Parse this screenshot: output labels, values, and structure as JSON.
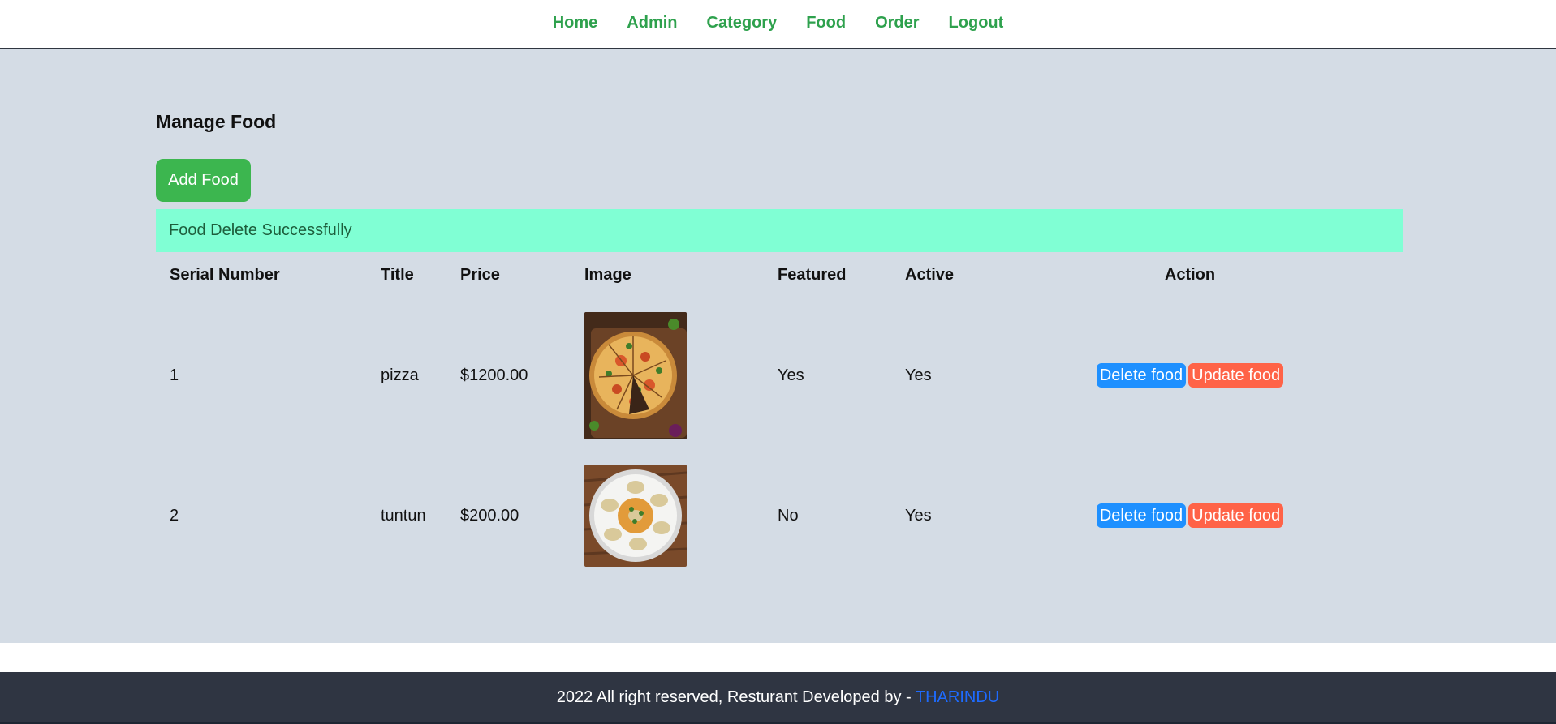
{
  "nav": {
    "items": [
      {
        "label": "Home"
      },
      {
        "label": "Admin"
      },
      {
        "label": "Category"
      },
      {
        "label": "Food"
      },
      {
        "label": "Order"
      },
      {
        "label": "Logout"
      }
    ]
  },
  "main": {
    "title": "Manage Food",
    "add_button_label": "Add Food",
    "alert_message": "Food Delete Successfully"
  },
  "table": {
    "headers": [
      "Serial Number",
      "Title",
      "Price",
      "Image",
      "Featured",
      "Active",
      "Action"
    ],
    "rows": [
      {
        "serial": "1",
        "title": "pizza",
        "price": "$1200.00",
        "image_icon": "pizza-image",
        "featured": "Yes",
        "active": "Yes",
        "delete_label": "Delete food",
        "update_label": "Update food"
      },
      {
        "serial": "2",
        "title": "tuntun",
        "price": "$200.00",
        "image_icon": "dumplings-image",
        "featured": "No",
        "active": "Yes",
        "delete_label": "Delete food",
        "update_label": "Update food"
      }
    ]
  },
  "footer": {
    "text": "2022 All right reserved, Resturant Developed by - ",
    "author": "THARINDU"
  },
  "colors": {
    "nav_link": "#2ea14d",
    "main_bg": "#d4dce5",
    "add_button": "#3cb64f",
    "alert_bg": "#80ffd4",
    "delete_button": "#1e90ff",
    "update_button": "#ff6347",
    "footer_bg": "#2f3542",
    "footer_link": "#1e6bff"
  }
}
